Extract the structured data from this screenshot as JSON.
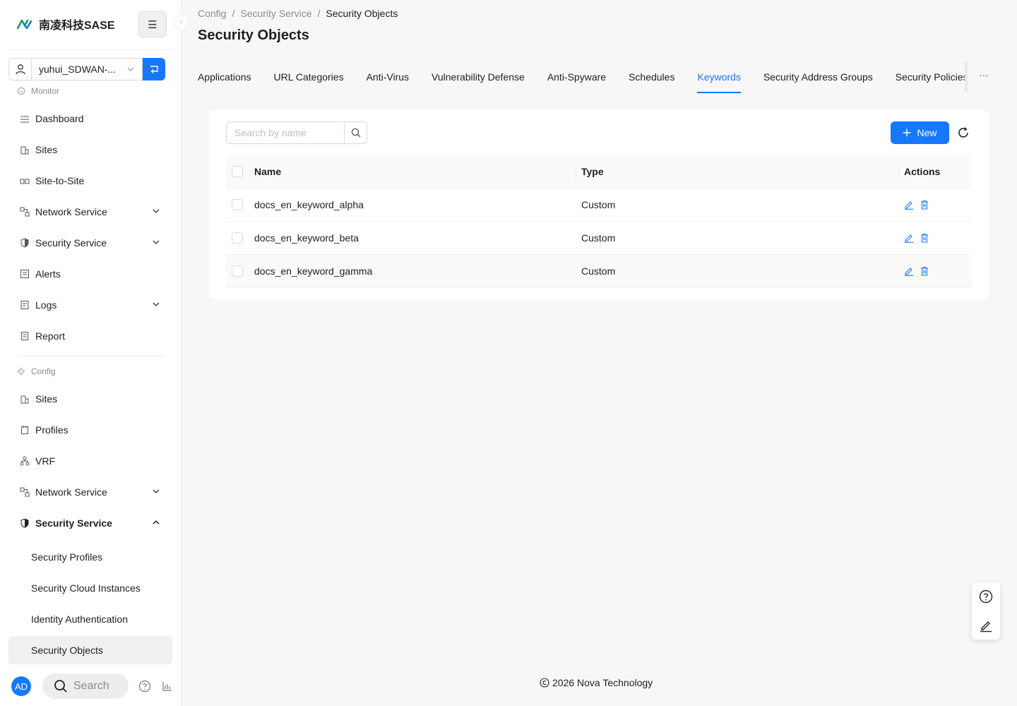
{
  "brand": {
    "name": "南凌科技SASE"
  },
  "tenant": {
    "value": "yuhui_SDWAN-..."
  },
  "sidebar": {
    "monitor_label": "Monitor",
    "monitor_items": [
      {
        "label": "Dashboard",
        "icon": "dashboard-icon"
      },
      {
        "label": "Sites",
        "icon": "building-icon"
      },
      {
        "label": "Site-to-Site",
        "icon": "site-link-icon"
      },
      {
        "label": "Network Service",
        "icon": "network-icon"
      },
      {
        "label": "Security Service",
        "icon": "shield-icon"
      },
      {
        "label": "Alerts",
        "icon": "alert-icon"
      },
      {
        "label": "Logs",
        "icon": "logs-icon"
      },
      {
        "label": "Report",
        "icon": "report-icon"
      }
    ],
    "config_label": "Config",
    "config_items": [
      {
        "label": "Sites",
        "icon": "building-icon"
      },
      {
        "label": "Profiles",
        "icon": "profile-icon"
      },
      {
        "label": "VRF",
        "icon": "vrf-icon"
      },
      {
        "label": "Network Service",
        "icon": "network-icon"
      },
      {
        "label": "Security Service",
        "icon": "shield-icon"
      }
    ],
    "security_sub": [
      {
        "label": "Security Profiles"
      },
      {
        "label": "Security Cloud Instances"
      },
      {
        "label": "Identity Authentication"
      },
      {
        "label": "Security Objects"
      }
    ],
    "avatar": "AD",
    "search_label": "Search"
  },
  "breadcrumb": [
    "Config",
    "Security Service",
    "Security Objects"
  ],
  "page_title": "Security Objects",
  "tabs": [
    {
      "label": "Applications"
    },
    {
      "label": "URL Categories"
    },
    {
      "label": "Anti-Virus"
    },
    {
      "label": "Vulnerability Defense"
    },
    {
      "label": "Anti-Spyware"
    },
    {
      "label": "Schedules"
    },
    {
      "label": "Keywords"
    },
    {
      "label": "Security Address Groups"
    },
    {
      "label": "Security Policies"
    }
  ],
  "tabs_more": "···",
  "toolbar": {
    "search_placeholder": "Search by name",
    "new_label": "New"
  },
  "table": {
    "headers": {
      "name": "Name",
      "type": "Type",
      "actions": "Actions"
    },
    "rows": [
      {
        "name": "docs_en_keyword_alpha",
        "type": "Custom"
      },
      {
        "name": "docs_en_keyword_beta",
        "type": "Custom"
      },
      {
        "name": "docs_en_keyword_gamma",
        "type": "Custom"
      }
    ]
  },
  "footer": "2026 Nova Technology",
  "colors": {
    "accent": "#1677ff",
    "selected_bg": "#f0f0f0",
    "page_bg": "#f7f7f7"
  }
}
